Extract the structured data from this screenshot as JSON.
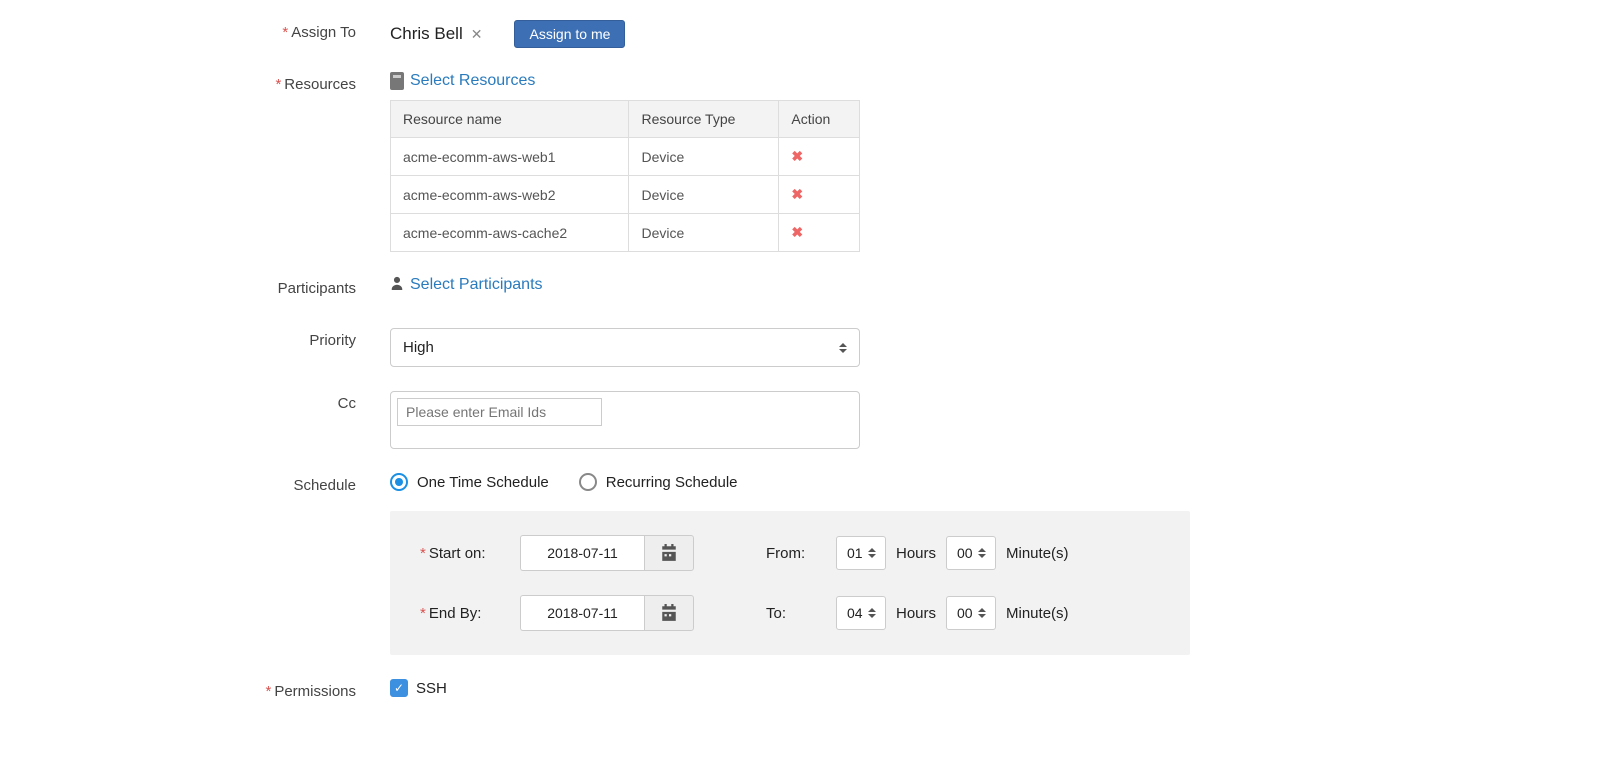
{
  "labels": {
    "assign_to": "Assign To",
    "resources": "Resources",
    "participants": "Participants",
    "priority": "Priority",
    "cc": "Cc",
    "schedule": "Schedule",
    "permissions": "Permissions"
  },
  "assign": {
    "name": "Chris Bell",
    "button": "Assign to me"
  },
  "resources": {
    "select_link": "Select Resources",
    "headers": {
      "name": "Resource name",
      "type": "Resource Type",
      "action": "Action"
    },
    "rows": [
      {
        "name": "acme-ecomm-aws-web1",
        "type": "Device"
      },
      {
        "name": "acme-ecomm-aws-web2",
        "type": "Device"
      },
      {
        "name": "acme-ecomm-aws-cache2",
        "type": "Device"
      }
    ]
  },
  "participants": {
    "select_link": "Select Participants"
  },
  "priority": {
    "value": "High"
  },
  "cc": {
    "placeholder": "Please enter Email Ids"
  },
  "schedule": {
    "one_time": "One Time Schedule",
    "recurring": "Recurring Schedule",
    "start_label": "Start on:",
    "end_label": "End By:",
    "from_label": "From:",
    "to_label": "To:",
    "start_date": "2018-07-11",
    "end_date": "2018-07-11",
    "from_hours": "01",
    "from_minutes": "00",
    "to_hours": "04",
    "to_minutes": "00",
    "hours_unit": "Hours",
    "minutes_unit": "Minute(s)"
  },
  "permissions": {
    "ssh": "SSH"
  }
}
